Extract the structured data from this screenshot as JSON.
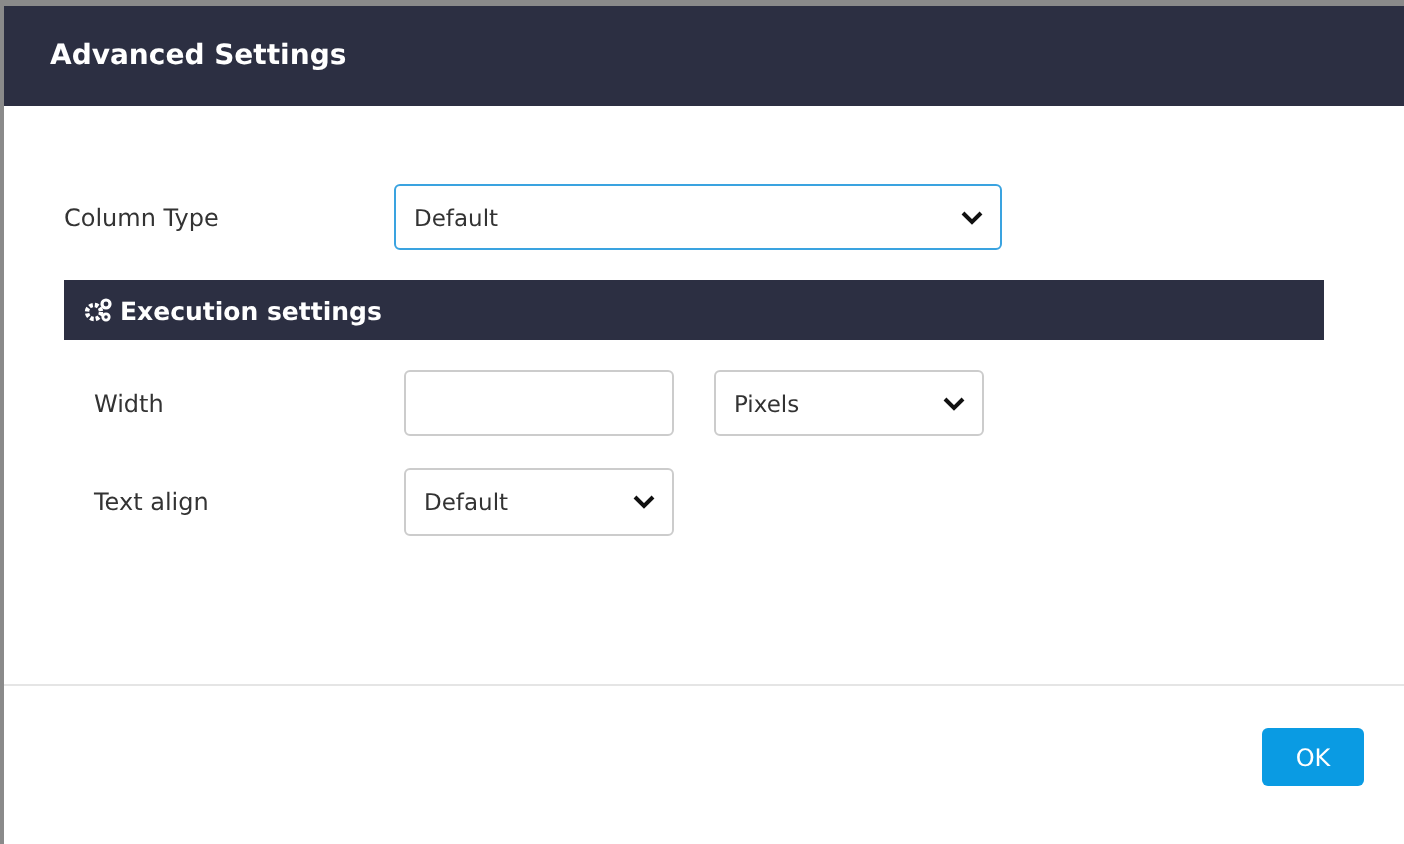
{
  "dialog": {
    "title": "Advanced Settings"
  },
  "column_type": {
    "label": "Column Type",
    "value": "Default",
    "focused": true
  },
  "section": {
    "title": "Execution settings"
  },
  "fields": [
    {
      "kind": "width",
      "label": "Width",
      "unit": "Pixels"
    },
    {
      "kind": "select",
      "label": "Text align",
      "value": "Default"
    }
  ],
  "buttons": [
    {
      "label": "OK"
    }
  ]
}
